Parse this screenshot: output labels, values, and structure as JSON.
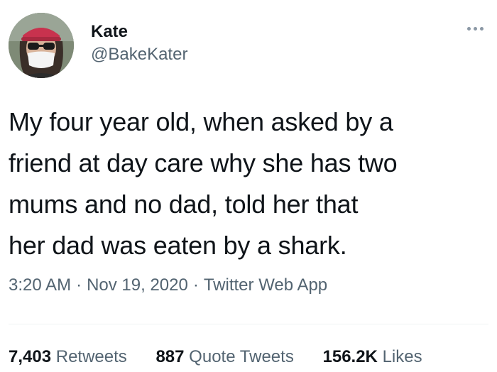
{
  "user": {
    "display_name": "Kate",
    "handle": "@BakeKater"
  },
  "tweet": {
    "text": "My four year old, when asked by a\nfriend at day care why she has two\nmums and no dad, told her that\nher dad was eaten by a shark.",
    "time": "3:20 AM",
    "date": "Nov 19, 2020",
    "source": "Twitter Web App",
    "separator": "·"
  },
  "stats": {
    "retweets_count": "7,403",
    "retweets_label": "Retweets",
    "quote_tweets_count": "887",
    "quote_tweets_label": "Quote Tweets",
    "likes_count": "156.2K",
    "likes_label": "Likes"
  },
  "colors": {
    "text_primary": "#0f1419",
    "text_secondary": "#536471",
    "divider": "#eff3f4"
  },
  "icons": {
    "more": "more-horizontal-icon"
  }
}
